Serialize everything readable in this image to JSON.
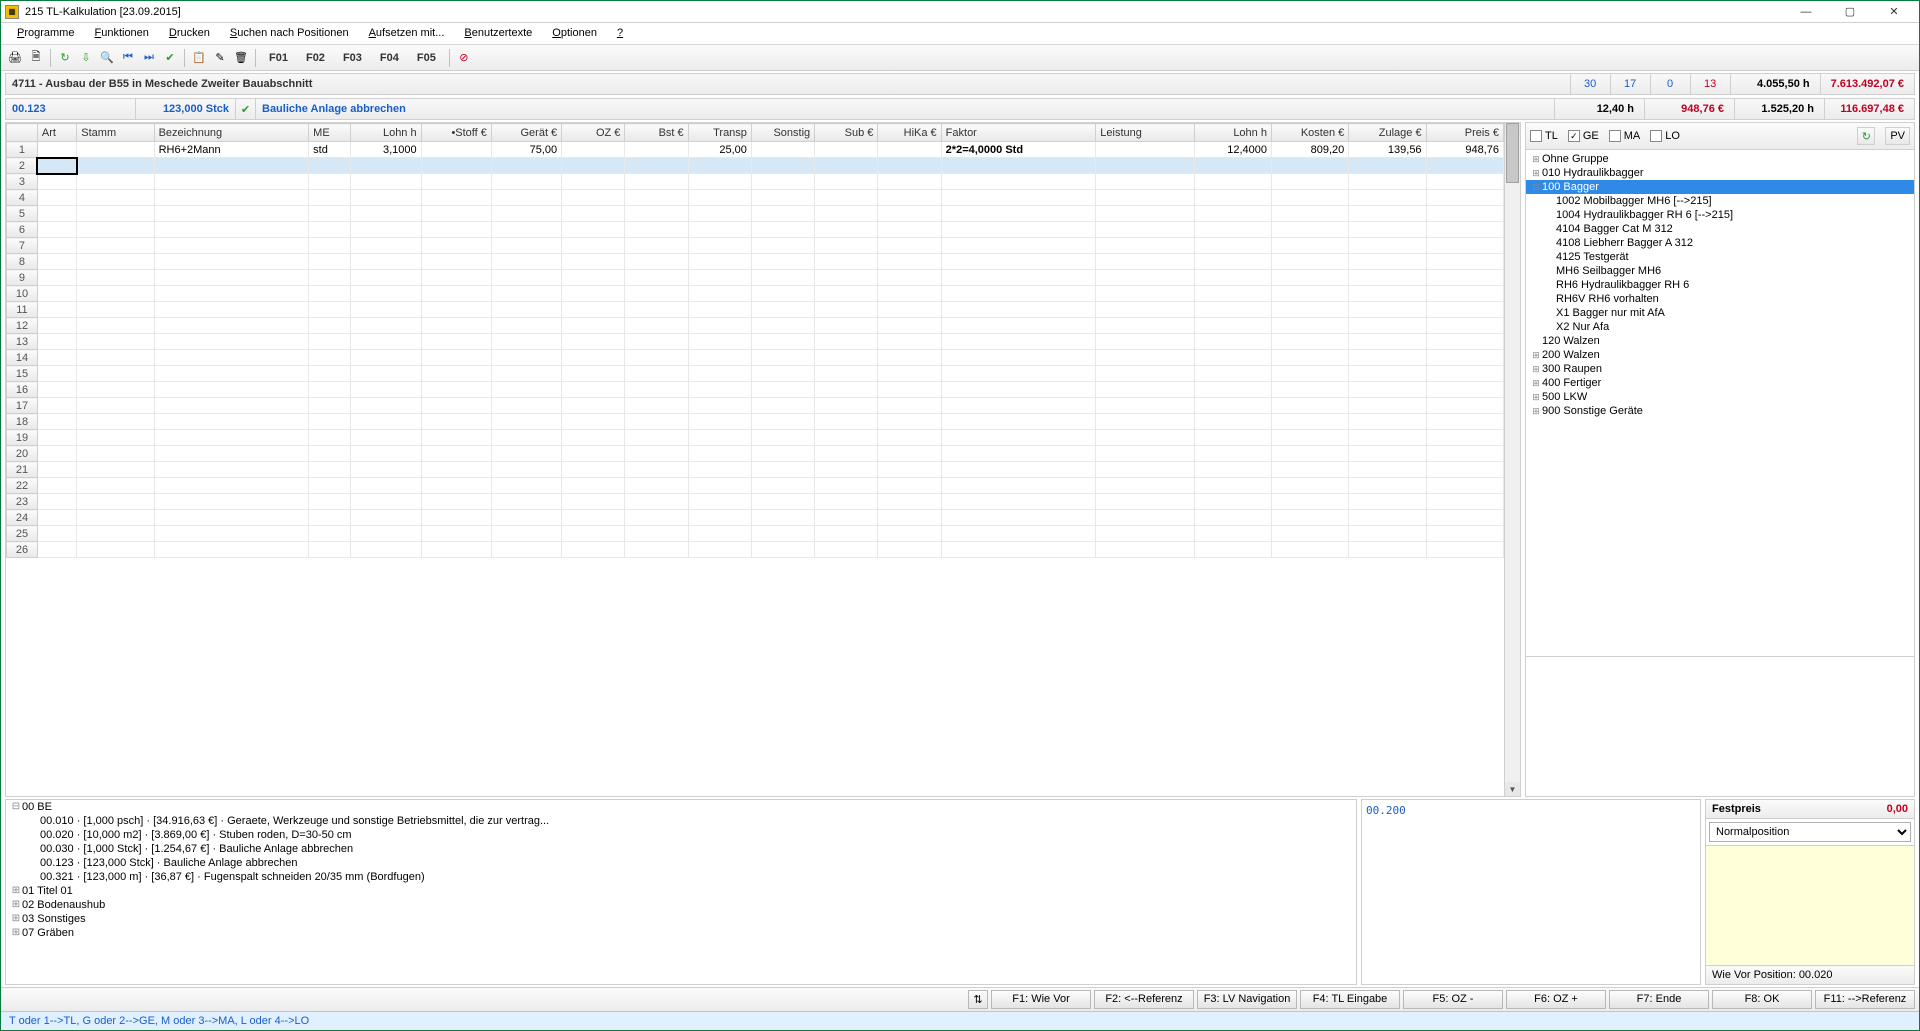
{
  "title": "215 TL-Kalkulation [23.09.2015]",
  "menu": [
    "Programme",
    "Funktionen",
    "Drucken",
    "Suchen nach Positionen",
    "Aufsetzen mit...",
    "Benutzertexte",
    "Optionen",
    "?"
  ],
  "fbuttons": [
    "F01",
    "F02",
    "F03",
    "F04",
    "F05"
  ],
  "project": {
    "title": "4711 - Ausbau der B55 in Meschede Zweiter Bauabschnitt",
    "c1": "30",
    "c2": "17",
    "c3": "0",
    "c4": "13",
    "hours": "4.055,50 h",
    "total": "7.613.492,07 €"
  },
  "position": {
    "code": "00.123",
    "qty": "123,000 Stck",
    "desc": "Bauliche Anlage abbrechen",
    "v1": "12,40 h",
    "v2": "948,76 €",
    "v3": "1.525,20 h",
    "v4": "116.697,48 €"
  },
  "grid": {
    "headers": [
      "Art",
      "Stamm",
      "Bezeichnung",
      "ME",
      "Lohn h",
      "•Stoff €",
      "Gerät €",
      "OZ €",
      "Bst €",
      "Transp",
      "Sonstig",
      "Sub €",
      "HiKa €",
      "Faktor",
      "Leistung",
      "Lohn h",
      "Kosten €",
      "Zulage €",
      "Preis €"
    ],
    "row1": {
      "bez": "RH6+2Mann",
      "me": "std",
      "lohn": "3,1000",
      "geraet": "75,00",
      "transp": "25,00",
      "faktor": "2*2=4,0000 Std",
      "lohnh": "12,4000",
      "kosten": "809,20",
      "zulage": "139,56",
      "preis": "948,76"
    },
    "rowcount": 26
  },
  "filter": {
    "tl": "TL",
    "ge": "GE",
    "ma": "MA",
    "lo": "LO",
    "pv": "PV"
  },
  "tree": [
    {
      "d": 0,
      "exp": "+",
      "label": "Ohne Gruppe"
    },
    {
      "d": 0,
      "exp": "+",
      "label": "010 Hydraulikbagger"
    },
    {
      "d": 0,
      "exp": "−",
      "label": "100 Bagger",
      "sel": true
    },
    {
      "d": 1,
      "exp": "",
      "label": "1002 Mobilbagger MH6 [-->215]"
    },
    {
      "d": 1,
      "exp": "",
      "label": "1004 Hydraulikbagger RH 6 [-->215]"
    },
    {
      "d": 1,
      "exp": "",
      "label": "4104 Bagger Cat M 312"
    },
    {
      "d": 1,
      "exp": "",
      "label": "4108 Liebherr Bagger A 312"
    },
    {
      "d": 1,
      "exp": "",
      "label": "4125 Testgerät"
    },
    {
      "d": 1,
      "exp": "",
      "label": "MH6 Seilbagger MH6"
    },
    {
      "d": 1,
      "exp": "",
      "label": "RH6 Hydraulikbagger RH 6"
    },
    {
      "d": 1,
      "exp": "",
      "label": "RH6V RH6 vorhalten"
    },
    {
      "d": 1,
      "exp": "",
      "label": "X1 Bagger nur mit AfA"
    },
    {
      "d": 1,
      "exp": "",
      "label": "X2 Nur Afa"
    },
    {
      "d": 0,
      "exp": "",
      "label": "120 Walzen"
    },
    {
      "d": 0,
      "exp": "+",
      "label": "200 Walzen"
    },
    {
      "d": 0,
      "exp": "+",
      "label": "300 Raupen"
    },
    {
      "d": 0,
      "exp": "+",
      "label": "400 Fertiger"
    },
    {
      "d": 0,
      "exp": "+",
      "label": "500 LKW"
    },
    {
      "d": 0,
      "exp": "+",
      "label": "900 Sonstige Geräte"
    }
  ],
  "btree": [
    {
      "d": 0,
      "exp": "−",
      "label": "00 BE"
    },
    {
      "d": 1,
      "exp": "",
      "label": "00.010 · [1,000 psch] · [34.916,63 €] · Geraete, Werkzeuge und sonstige Betriebsmittel, die zur vertrag..."
    },
    {
      "d": 1,
      "exp": "",
      "label": "00.020 · [10,000 m2] · [3.869,00 €] · Stuben roden, D=30-50 cm"
    },
    {
      "d": 1,
      "exp": "",
      "label": "00.030 · [1,000 Stck] · [1.254,67 €] · Bauliche Anlage abbrechen"
    },
    {
      "d": 1,
      "exp": "",
      "label": "00.123 · [123,000 Stck] · Bauliche Anlage abbrechen",
      "sel": true
    },
    {
      "d": 1,
      "exp": "",
      "label": "00.321 · [123,000 m] · [36,87 €] · Fugenspalt schneiden 20/35 mm (Bordfugen)"
    },
    {
      "d": 0,
      "exp": "+",
      "label": "01 Titel 01"
    },
    {
      "d": 0,
      "exp": "+",
      "label": "02 Bodenaushub"
    },
    {
      "d": 0,
      "exp": "+",
      "label": "03 Sonstiges"
    },
    {
      "d": 0,
      "exp": "+",
      "label": "07 Gräben"
    }
  ],
  "bp2": "00.200",
  "fp": {
    "label": "Festpreis",
    "value": "0,00",
    "dd": "Normalposition",
    "wv": "Wie Vor Position: 00.020"
  },
  "fkeys": [
    "F1: Wie Vor",
    "F2: <--Referenz",
    "F3: LV Navigation",
    "F4: TL Eingabe",
    "F5: OZ -",
    "F6: OZ +",
    "F7: Ende",
    "F8: OK",
    "F11: -->Referenz"
  ],
  "status": "T oder 1-->TL, G oder 2-->GE, M oder 3-->MA, L oder 4-->LO"
}
